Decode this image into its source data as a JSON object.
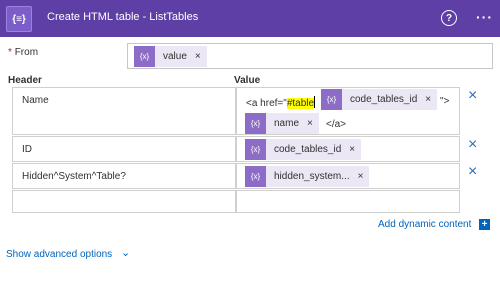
{
  "header": {
    "app_icon": "{≡}",
    "title": "Create HTML table - ListTables",
    "help_icon": "?",
    "more_icon": "···"
  },
  "from": {
    "required_mark": "*",
    "label": "From",
    "token": {
      "icon": "{x}",
      "label": "value",
      "close": "×"
    }
  },
  "columns": {
    "header": "Header",
    "value": "Value"
  },
  "rows": [
    {
      "header": "Name",
      "value_prefix": "<a href=\"",
      "value_highlight": "#table",
      "token1": {
        "icon": "{x}",
        "label": "code_tables_id",
        "close": "×"
      },
      "value_mid": "\">",
      "token2": {
        "icon": "{x}",
        "label": "name",
        "close": "×"
      },
      "value_suffix": "</a>",
      "delete": "×"
    },
    {
      "header": "ID",
      "token": {
        "icon": "{x}",
        "label": "code_tables_id",
        "close": "×"
      },
      "delete": "×"
    },
    {
      "header": "Hidden^System^Table?",
      "token": {
        "icon": "{x}",
        "label": "hidden_system...",
        "close": "×"
      },
      "delete": "×"
    },
    {
      "header": "",
      "value": ""
    }
  ],
  "add_dynamic_content": {
    "label": "Add dynamic content",
    "icon": "+"
  },
  "advanced": {
    "label": "Show advanced options",
    "chevron": "⌄"
  },
  "colors": {
    "header_bg": "#5d3fa6",
    "token_icon": "#8c6cc6",
    "token_bg": "#ece7f5",
    "link": "#0064bf"
  }
}
